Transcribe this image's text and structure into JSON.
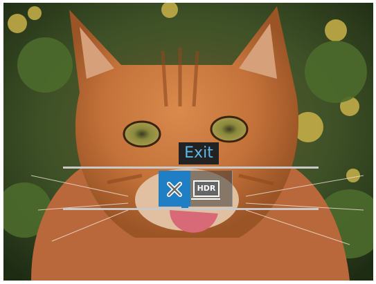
{
  "camera_menu": {
    "tooltip": "Exit",
    "options": [
      {
        "id": "exit",
        "icon": "close-icon",
        "selected": true
      },
      {
        "id": "hdr",
        "icon": "hdr-icon",
        "label": "HDR",
        "selected": false
      }
    ],
    "accent_color": "#1f7ec4",
    "tooltip_text_color": "#5fb7ea"
  }
}
